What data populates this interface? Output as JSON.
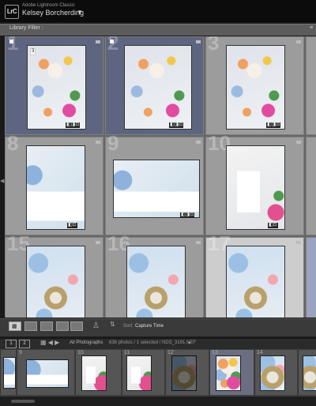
{
  "app": {
    "logo": "LrC",
    "name": "Adobe Lightroom Classic",
    "user": "Kelsey Borcherding",
    "user_chevron": "▼"
  },
  "filter_bar": {
    "label": "Library Filter :",
    "close": "≡"
  },
  "grid": {
    "cells": [
      {
        "number": "1",
        "selected": true,
        "badge": "3",
        "photo": "flatlay"
      },
      {
        "number": "2",
        "selected": true,
        "photo": "flatlay"
      },
      {
        "number": "3",
        "selected": false,
        "photo": "flatlay"
      },
      {
        "number": "8",
        "selected": false,
        "photo": "envel"
      },
      {
        "number": "9",
        "selected": false,
        "photo": "envel"
      },
      {
        "number": "10",
        "selected": false,
        "photo": "cards"
      },
      {
        "number": "15",
        "selected": false,
        "photo": "frame"
      },
      {
        "number": "16",
        "selected": false,
        "photo": "frame"
      },
      {
        "number": "17",
        "selected": false,
        "photo": "frame",
        "light": true
      }
    ]
  },
  "toolbar": {
    "sort_label": "Sort:",
    "sort_value": "Capture Time",
    "grid_icon": "grid-view-icon",
    "painter_icon": "spray-can-icon"
  },
  "bottom_bar": {
    "page1": "1",
    "page2": "2",
    "source_label": "All Photographs",
    "source_info": "636 photos / 1 selected / NDS_3191.NEF",
    "source_chevron": "▾"
  },
  "filmstrip": {
    "cells": [
      {
        "number": "",
        "photo": "envel"
      },
      {
        "number": "9",
        "photo": "envel"
      },
      {
        "number": "10",
        "photo": "cards"
      },
      {
        "number": "11",
        "photo": "cards"
      },
      {
        "number": "12",
        "photo": "frame"
      },
      {
        "number": "13",
        "photo": "flatlay",
        "selected": true
      },
      {
        "number": "14",
        "photo": "frame"
      },
      {
        "number": "",
        "photo": "frame"
      }
    ]
  },
  "colors": {
    "selected_cell": "#5d6580",
    "cell": "#9c9c9c",
    "background": "#1a1a1a"
  }
}
